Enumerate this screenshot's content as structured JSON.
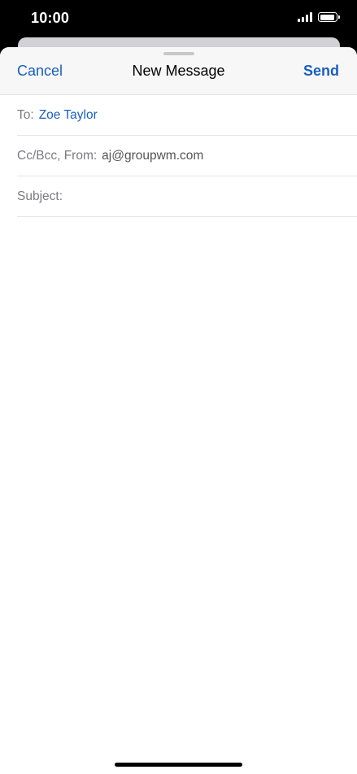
{
  "status_bar": {
    "time": "10:00"
  },
  "compose": {
    "nav": {
      "cancel_label": "Cancel",
      "title": "New Message",
      "send_label": "Send"
    },
    "to": {
      "label": "To:",
      "recipient": "Zoe Taylor"
    },
    "cc_from": {
      "label": "Cc/Bcc, From:",
      "value": "aj@groupwm.com"
    },
    "subject": {
      "label": "Subject:",
      "value": ""
    },
    "body": ""
  },
  "colors": {
    "accent": "#1a5fbf",
    "header_bg": "#f7f7f7"
  },
  "icons": [
    "signal-icon",
    "battery-icon"
  ]
}
